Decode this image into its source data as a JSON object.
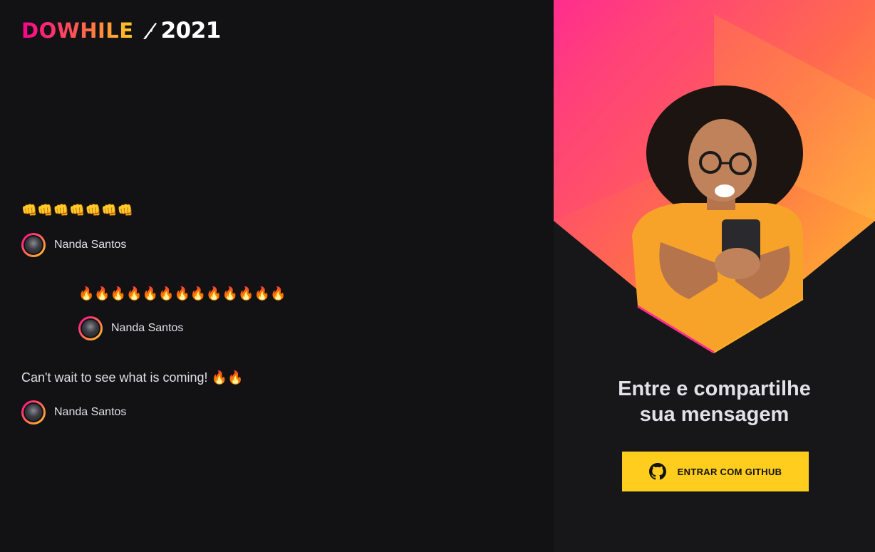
{
  "logo": {
    "brand": "DOWHILE",
    "year": "2021"
  },
  "messages": [
    {
      "content": "👊👊👊👊👊👊👊",
      "user": "Nanda Santos"
    },
    {
      "content": "🔥🔥🔥🔥🔥🔥🔥🔥🔥🔥🔥🔥🔥",
      "user": "Nanda Santos"
    },
    {
      "content": "Can't wait to see what is coming! 🔥🔥",
      "user": "Nanda Santos"
    }
  ],
  "login": {
    "title_line1": "Entre e compartilhe",
    "title_line2": "sua mensagem",
    "button_label": "ENTRAR COM GITHUB",
    "button_icon": "github-icon"
  },
  "colors": {
    "background": "#121214",
    "accent_yellow": "#ffcd1e",
    "accent_pink": "#ff008e"
  }
}
